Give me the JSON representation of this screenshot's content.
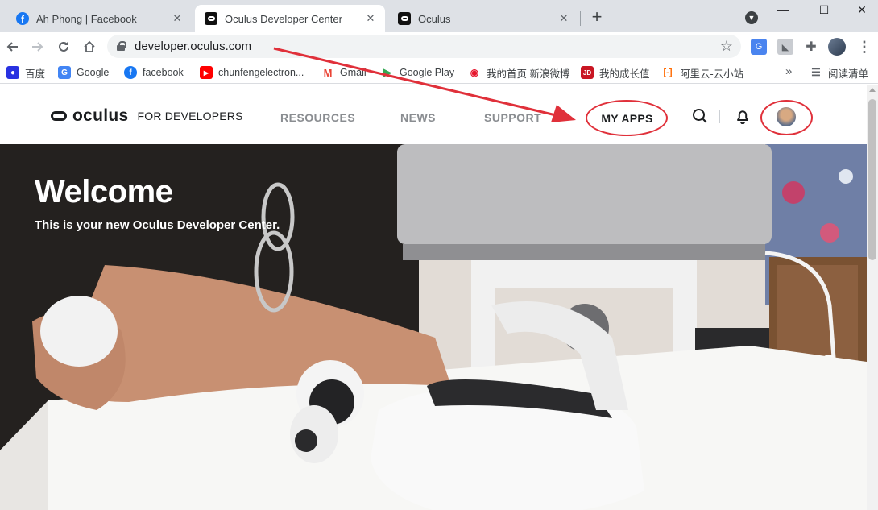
{
  "browser": {
    "tabs": [
      {
        "title": "Ah Phong | Facebook",
        "icon": "facebook-icon",
        "active": false
      },
      {
        "title": "Oculus Developer Center",
        "icon": "oculus-icon",
        "active": true
      },
      {
        "title": "Oculus",
        "icon": "oculus-icon",
        "active": false
      }
    ],
    "close_glyph": "✕",
    "new_tab_glyph": "+",
    "window_controls": {
      "minimize": "—",
      "maximize": "☐",
      "close": "✕"
    },
    "url": "developer.oculus.com",
    "bookmarks": [
      {
        "label": "百度",
        "icon": "baidu-icon",
        "color": "#2932e1",
        "glyph": "🐾"
      },
      {
        "label": "Google",
        "icon": "google-translate-icon",
        "color": "#4285f4",
        "glyph": "G"
      },
      {
        "label": "facebook",
        "icon": "facebook-icon",
        "color": "#1877f2",
        "glyph": "f"
      },
      {
        "label": "chunfengelectron...",
        "icon": "youtube-icon",
        "color": "#ff0000",
        "glyph": "▶"
      },
      {
        "label": "Gmail",
        "icon": "gmail-icon",
        "color": "#ea4335",
        "glyph": "M"
      },
      {
        "label": "Google Play",
        "icon": "google-play-icon",
        "color": "#34a853",
        "glyph": "▶"
      },
      {
        "label": "我的首页 新浪微博",
        "icon": "weibo-icon",
        "color": "#e6162d",
        "glyph": "W"
      },
      {
        "label": "我的成长值",
        "icon": "jd-icon",
        "color": "#c91623",
        "glyph": "JD"
      },
      {
        "label": "阿里云-云小站",
        "icon": "aliyun-icon",
        "color": "#ff6a00",
        "glyph": "[-]"
      }
    ],
    "bookmarks_more": "»",
    "reading_list": "阅读清单"
  },
  "site": {
    "logo_word": "oculus",
    "logo_sub": "FOR DEVELOPERS",
    "nav": [
      "RESOURCES",
      "NEWS",
      "SUPPORT"
    ],
    "my_apps": "MY APPS"
  },
  "hero": {
    "title": "Welcome",
    "subtitle": "This is your new Oculus Developer Center."
  },
  "colors": {
    "annotation_red": "#e0303a",
    "tab_strip": "#dee1e6"
  }
}
